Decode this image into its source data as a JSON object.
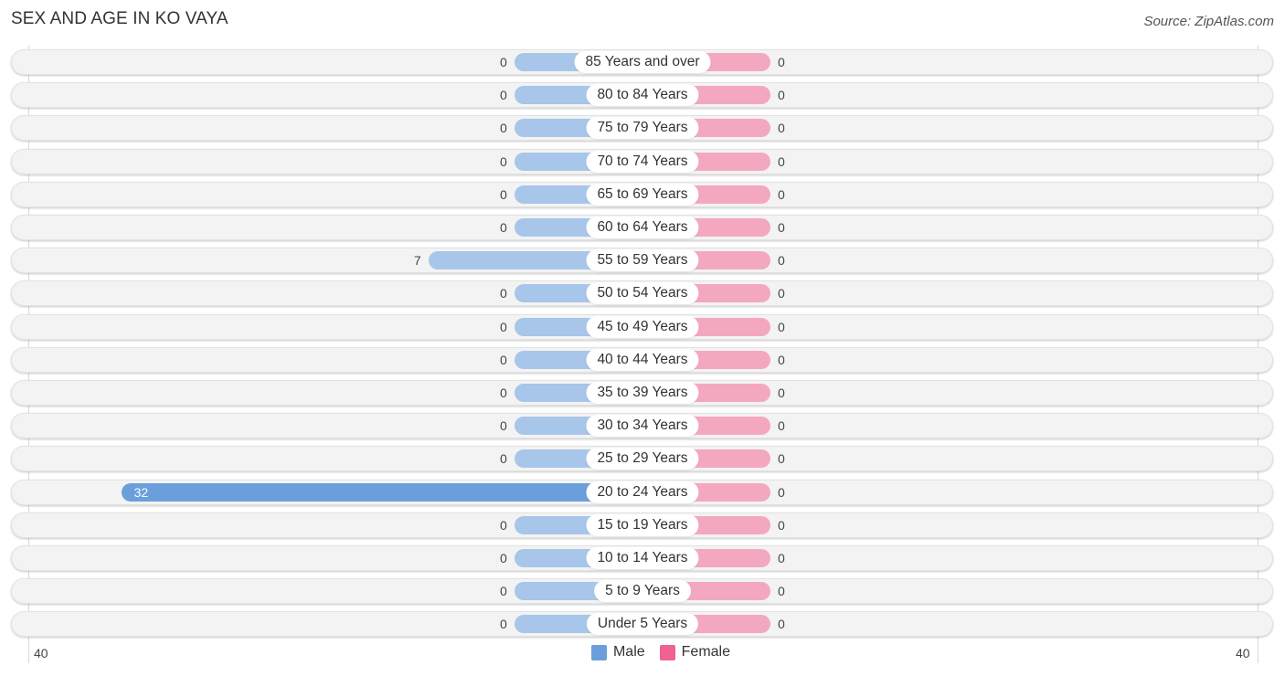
{
  "header": {
    "title": "SEX AND AGE IN KO VAYA",
    "source": "Source: ZipAtlas.com"
  },
  "colors": {
    "male": "#a7c6e9",
    "male_highlight": "#6a9fdb",
    "female": "#f4a8c0",
    "legend_male": "#6a9fdb",
    "legend_female": "#f06292"
  },
  "chart_data": {
    "type": "bar",
    "orientation": "horizontal-diverging",
    "title": "SEX AND AGE IN KO VAYA",
    "categories": [
      "85 Years and over",
      "80 to 84 Years",
      "75 to 79 Years",
      "70 to 74 Years",
      "65 to 69 Years",
      "60 to 64 Years",
      "55 to 59 Years",
      "50 to 54 Years",
      "45 to 49 Years",
      "40 to 44 Years",
      "35 to 39 Years",
      "30 to 34 Years",
      "25 to 29 Years",
      "20 to 24 Years",
      "15 to 19 Years",
      "10 to 14 Years",
      "5 to 9 Years",
      "Under 5 Years"
    ],
    "series": [
      {
        "name": "Male",
        "values": [
          0,
          0,
          0,
          0,
          0,
          0,
          7,
          0,
          0,
          0,
          0,
          0,
          0,
          32,
          0,
          0,
          0,
          0
        ]
      },
      {
        "name": "Female",
        "values": [
          0,
          0,
          0,
          0,
          0,
          0,
          0,
          0,
          0,
          0,
          0,
          0,
          0,
          0,
          0,
          0,
          0,
          0
        ]
      }
    ],
    "xlim": [
      -40,
      40
    ],
    "tick_labels": {
      "left": "40",
      "right": "40"
    },
    "legend": {
      "entries": [
        "Male",
        "Female"
      ],
      "placement": "bottom-center"
    },
    "grid": false
  }
}
